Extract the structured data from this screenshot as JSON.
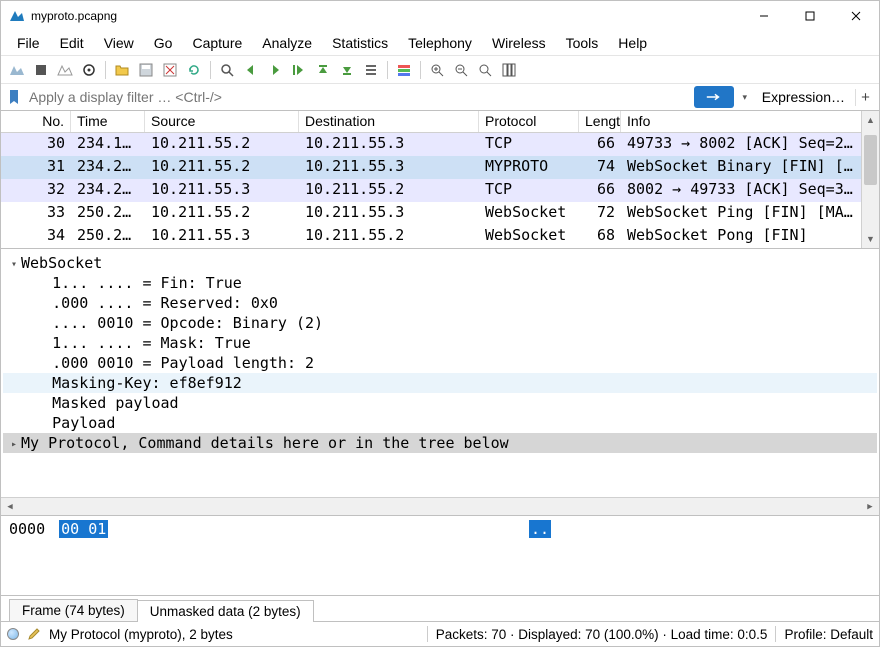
{
  "window": {
    "title": "myproto.pcapng"
  },
  "menu": {
    "items": [
      "File",
      "Edit",
      "View",
      "Go",
      "Capture",
      "Analyze",
      "Statistics",
      "Telephony",
      "Wireless",
      "Tools",
      "Help"
    ]
  },
  "filter": {
    "placeholder": "Apply a display filter … <Ctrl-/>",
    "expression_label": "Expression…",
    "plus_label": "+"
  },
  "packet_columns": [
    "No.",
    "Time",
    "Source",
    "Destination",
    "Protocol",
    "Length",
    "Info"
  ],
  "packets": [
    {
      "no": "30",
      "time": "234.1…",
      "src": "10.211.55.2",
      "dst": "10.211.55.3",
      "proto": "TCP",
      "len": "66",
      "info": "49733 → 8002 [ACK] Seq=2…",
      "cls": "row-tcp"
    },
    {
      "no": "31",
      "time": "234.2…",
      "src": "10.211.55.2",
      "dst": "10.211.55.3",
      "proto": "MYPROTO",
      "len": "74",
      "info": "WebSocket Binary [FIN] […",
      "cls": "row-sel"
    },
    {
      "no": "32",
      "time": "234.2…",
      "src": "10.211.55.3",
      "dst": "10.211.55.2",
      "proto": "TCP",
      "len": "66",
      "info": "8002 → 49733 [ACK] Seq=3…",
      "cls": "row-tcp"
    },
    {
      "no": "33",
      "time": "250.2…",
      "src": "10.211.55.2",
      "dst": "10.211.55.3",
      "proto": "WebSocket",
      "len": "72",
      "info": "WebSocket Ping [FIN] [MA…",
      "cls": "row-ws"
    },
    {
      "no": "34",
      "time": "250.2…",
      "src": "10.211.55.3",
      "dst": "10.211.55.2",
      "proto": "WebSocket",
      "len": "68",
      "info": "WebSocket Pong [FIN]",
      "cls": "row-ws"
    }
  ],
  "details": {
    "section_ws": "WebSocket",
    "lines": [
      "1... .... = Fin: True",
      ".000 .... = Reserved: 0x0",
      ".... 0010 = Opcode: Binary (2)",
      "1... .... = Mask: True",
      ".000 0010 = Payload length: 2",
      "Masking-Key: ef8ef912",
      "Masked payload",
      "Payload"
    ],
    "section_myproto": "My Protocol, Command details here or in the tree below"
  },
  "hex": {
    "offset": "0000",
    "bytes": "00 01",
    "ascii": ".."
  },
  "tabs": {
    "frame": "Frame (74 bytes)",
    "unmasked": "Unmasked data (2 bytes)"
  },
  "status": {
    "proto": "My Protocol (myproto), 2 bytes",
    "packets": "Packets: 70 · Displayed: 70 (100.0%) · Load time: 0:0.5",
    "profile": "Profile: Default"
  }
}
